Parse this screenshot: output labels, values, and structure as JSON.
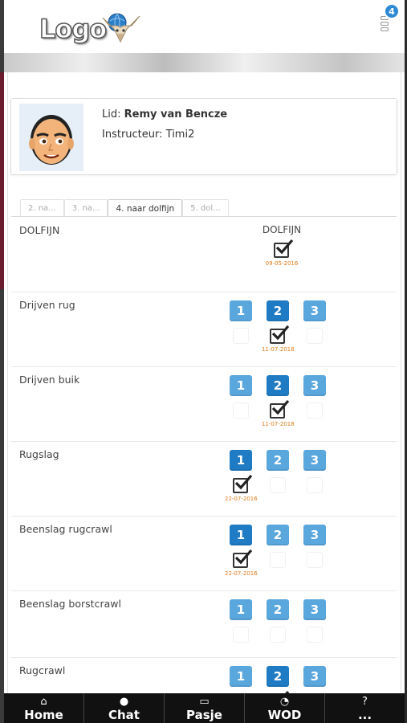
{
  "header": {
    "logo_text": "Logo",
    "notification_count": "4"
  },
  "profile": {
    "member_label": "Lid:",
    "member_name": "Remy van Bencze",
    "instructor_label": "Instructeur:",
    "instructor_name": "Timi2"
  },
  "tabs": [
    {
      "label": "2. na..."
    },
    {
      "label": "3. na..."
    },
    {
      "label": "4. naar dolfijn"
    },
    {
      "label": "5. dol..."
    }
  ],
  "active_tab_index": 2,
  "overview": {
    "name": "DOLFIJN",
    "label": "DOLFIJN",
    "date": "09-05-2016"
  },
  "skills": [
    {
      "name": "Drijven rug",
      "levels": [
        "1",
        "2",
        "3"
      ],
      "done_level": 2,
      "date": "11-07-2018"
    },
    {
      "name": "Drijven buik",
      "levels": [
        "1",
        "2",
        "3"
      ],
      "done_level": 2,
      "date": "11-07-2018"
    },
    {
      "name": "Rugslag",
      "levels": [
        "1",
        "2",
        "3"
      ],
      "done_level": 1,
      "date": "22-07-2016"
    },
    {
      "name": "Beenslag rugcrawl",
      "levels": [
        "1",
        "2",
        "3"
      ],
      "done_level": 1,
      "date": "22-07-2016"
    },
    {
      "name": "Beenslag borstcrawl",
      "levels": [
        "1",
        "2",
        "3"
      ],
      "done_level": null,
      "date": ""
    },
    {
      "name": "Rugcrawl",
      "levels": [
        "1",
        "2",
        "3"
      ],
      "done_level": 2,
      "date": ""
    }
  ],
  "colors": {
    "level_active": "#1f7bc4",
    "level_inactive": "#5aa7de",
    "date": "#e07b1a",
    "badge": "#2d8ad6"
  },
  "bottom_nav": [
    {
      "label": "Home",
      "icon": "home-icon"
    },
    {
      "label": "Chat",
      "icon": "chat-icon"
    },
    {
      "label": "Pasje",
      "icon": "card-icon"
    },
    {
      "label": "WOD",
      "icon": "dashboard-icon"
    },
    {
      "label": "...",
      "icon": "help-icon",
      "glyph": "?"
    }
  ]
}
